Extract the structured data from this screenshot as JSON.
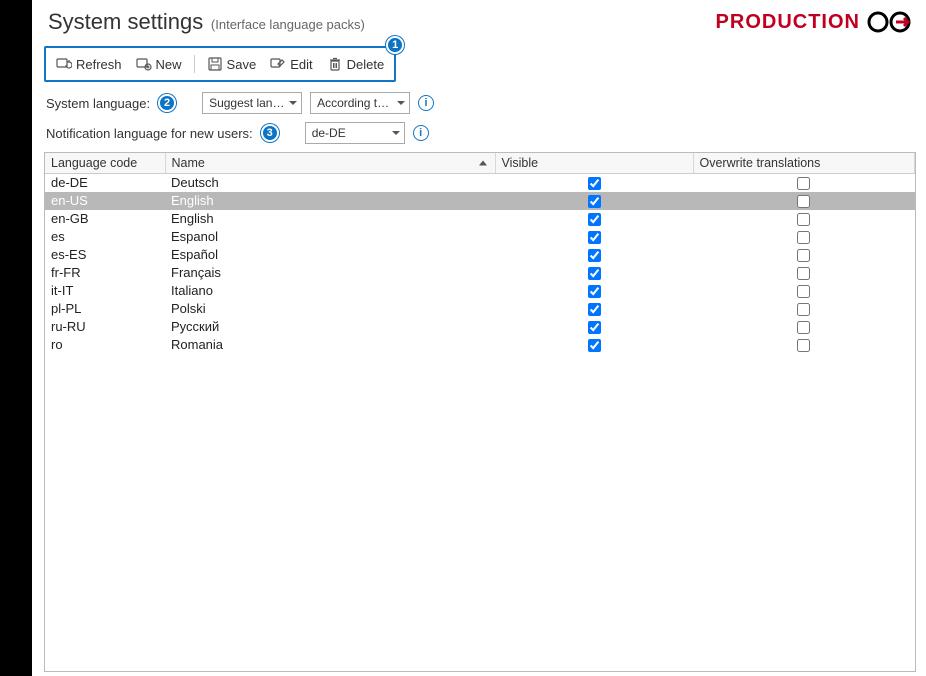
{
  "header": {
    "title": "System settings",
    "subtitle": "(Interface language packs)",
    "brand_text": "PRODUCTION"
  },
  "toolbar": {
    "refresh": "Refresh",
    "new": "New",
    "save": "Save",
    "edit": "Edit",
    "delete": "Delete"
  },
  "callouts": {
    "toolbar": "1",
    "system_language": "2",
    "notification_language": "3"
  },
  "settings": {
    "system_language_label": "System language:",
    "system_language_combo1": "Suggest lang…",
    "system_language_combo2": "According to …",
    "notification_label": "Notification language for new users:",
    "notification_value": "de-DE"
  },
  "grid": {
    "headers": {
      "code": "Language code",
      "name": "Name",
      "visible": "Visible",
      "overwrite": "Overwrite translations"
    },
    "rows": [
      {
        "code": "de-DE",
        "name": "Deutsch",
        "visible": true,
        "overwrite": false,
        "selected": false
      },
      {
        "code": "en-US",
        "name": "English",
        "visible": true,
        "overwrite": false,
        "selected": true
      },
      {
        "code": "en-GB",
        "name": "English",
        "visible": true,
        "overwrite": false,
        "selected": false
      },
      {
        "code": "es",
        "name": "Espanol",
        "visible": true,
        "overwrite": false,
        "selected": false
      },
      {
        "code": "es-ES",
        "name": "Español",
        "visible": true,
        "overwrite": false,
        "selected": false
      },
      {
        "code": "fr-FR",
        "name": "Français",
        "visible": true,
        "overwrite": false,
        "selected": false
      },
      {
        "code": "it-IT",
        "name": "Italiano",
        "visible": true,
        "overwrite": false,
        "selected": false
      },
      {
        "code": "pl-PL",
        "name": "Polski",
        "visible": true,
        "overwrite": false,
        "selected": false
      },
      {
        "code": "ru-RU",
        "name": "Русский",
        "visible": true,
        "overwrite": false,
        "selected": false
      },
      {
        "code": "ro",
        "name": "Romania",
        "visible": true,
        "overwrite": false,
        "selected": false
      }
    ]
  }
}
